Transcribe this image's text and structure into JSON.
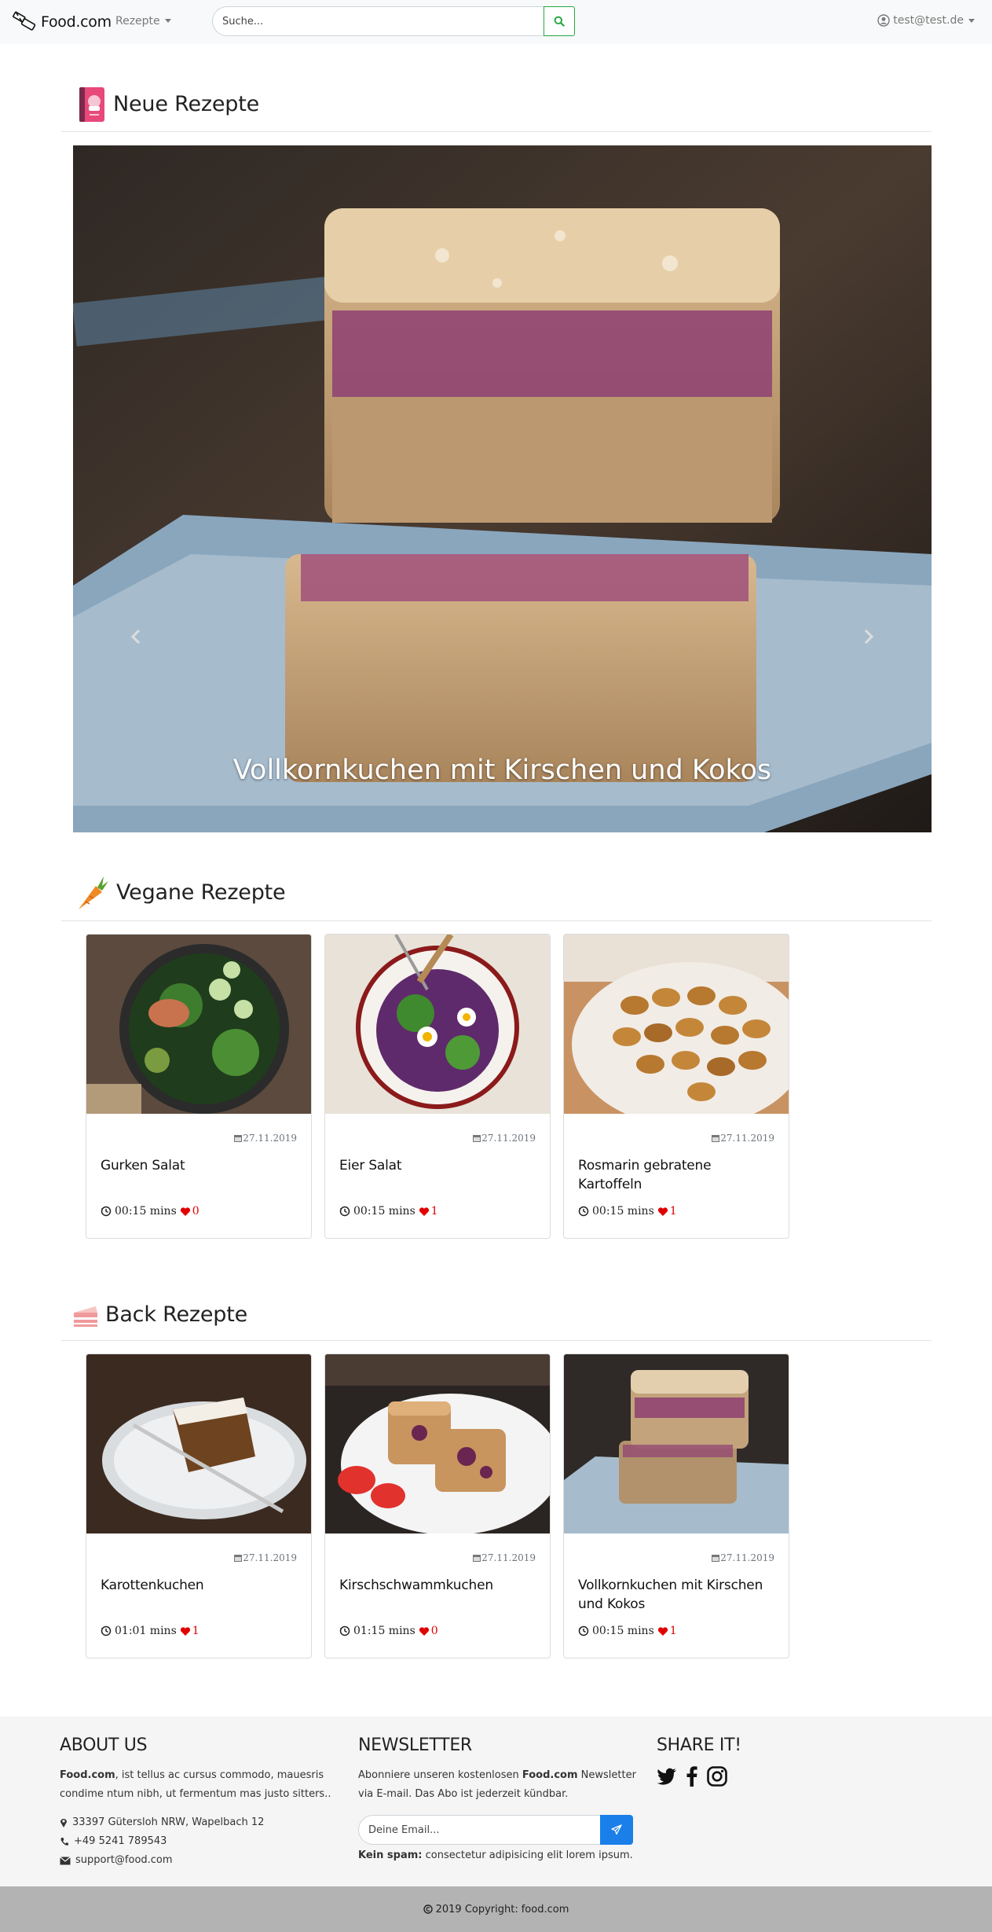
{
  "navbar": {
    "brand": "Food.com",
    "recipes_menu": "Rezepte",
    "search_placeholder": "Suche...",
    "user": "test@test.de"
  },
  "sections": {
    "new": "Neue Rezepte",
    "vegan": "Vegane Rezepte",
    "bake": "Back Rezepte"
  },
  "carousel": {
    "caption": "Vollkornkuchen mit Kirschen und Kokos"
  },
  "vegan_cards": [
    {
      "title": "Gurken Salat",
      "date": "27.11.2019",
      "time": "00:15 mins",
      "likes": "0"
    },
    {
      "title": "Eier Salat",
      "date": "27.11.2019",
      "time": "00:15 mins",
      "likes": "1"
    },
    {
      "title": "Rosmarin gebratene Kartoffeln",
      "date": "27.11.2019",
      "time": "00:15 mins",
      "likes": "1"
    }
  ],
  "bake_cards": [
    {
      "title": "Karottenkuchen",
      "date": "27.11.2019",
      "time": "01:01 mins",
      "likes": "1"
    },
    {
      "title": "Kirschschwammkuchen",
      "date": "27.11.2019",
      "time": "01:15 mins",
      "likes": "0"
    },
    {
      "title": "Vollkornkuchen mit Kirschen und Kokos",
      "date": "27.11.2019",
      "time": "00:15 mins",
      "likes": "1"
    }
  ],
  "footer": {
    "about_title": "ABOUT US",
    "about_brand": "Food.com",
    "about_text": ", ist tellus ac cursus commodo, mauesris condime ntum nibh, ut fermentum mas justo sitters..",
    "address": "33397 Gütersloh NRW, Wapelbach 12",
    "phone": "+49 5241 789543",
    "email": "support@food.com",
    "newsletter_title": "NEWSLETTER",
    "newsletter_text_1": "Abonniere unseren kostenlosen ",
    "newsletter_brand": "Food.com",
    "newsletter_text_2": " Newsletter via E-mail. Das Abo ist jederzeit kündbar.",
    "email_placeholder": "Deine Email...",
    "spam_bold": "Kein spam:",
    "spam_text": " consectetur adipisicing elit lorem ipsum.",
    "share_title": "SHARE IT!"
  },
  "copyright": {
    "text": "2019 Copyright: ",
    "brand": "food.com"
  },
  "colors": {
    "navbar_bg": "#f8f9fa",
    "search_accent": "#28a745",
    "like_red": "#e00000",
    "newsletter_button": "#1a7fe8",
    "footer_bg": "#f5f5f5",
    "copyright_bg": "#b3b3b3"
  },
  "icons": [
    "brand-icon",
    "caret-down-icon",
    "search-icon",
    "user-circle-icon",
    "cookbook-icon",
    "carrot-icon",
    "cake-icon",
    "chevron-left-icon",
    "chevron-right-icon",
    "calendar-icon",
    "clock-history-icon",
    "heart-icon",
    "map-marker-icon",
    "phone-icon",
    "envelope-icon",
    "paper-plane-icon",
    "twitter-icon",
    "facebook-icon",
    "instagram-icon",
    "copyright-icon"
  ]
}
